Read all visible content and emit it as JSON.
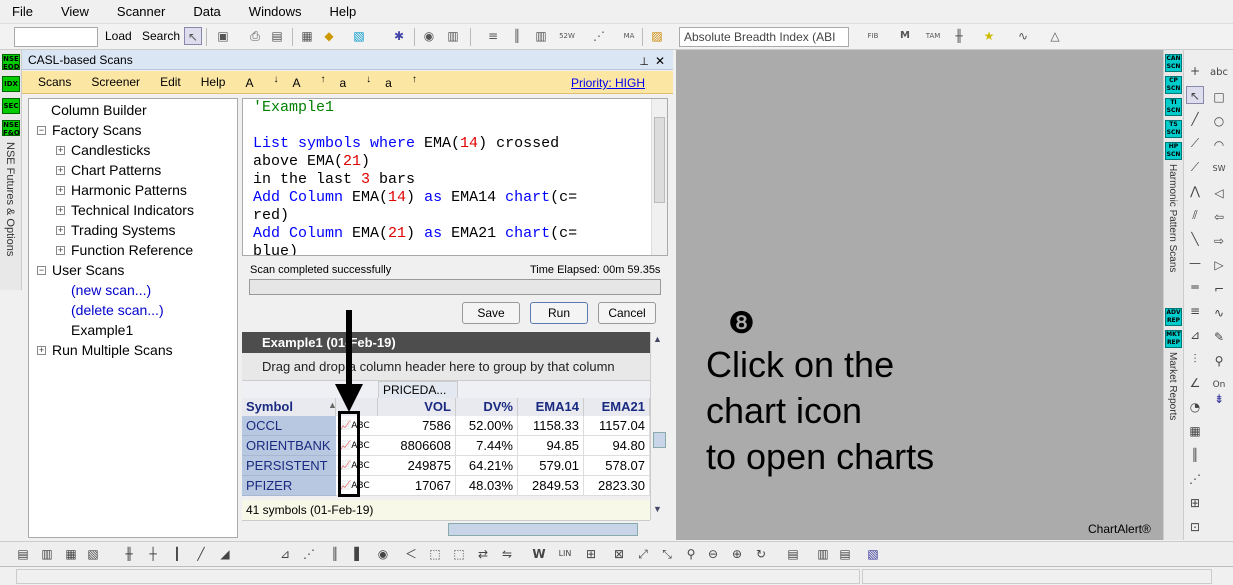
{
  "menu": [
    "File",
    "View",
    "Scanner",
    "Data",
    "Windows",
    "Help"
  ],
  "toolbar": {
    "load": "Load",
    "search": "Search",
    "indicator_select": "Absolute Breadth Index (ABI"
  },
  "left_badges": [
    "NSE EOD",
    "IDX",
    "SEC",
    "NSE F&O"
  ],
  "left_strip_label": "NSE Futures & Options",
  "panel": {
    "title": "CASL-based Scans"
  },
  "scan_menu": {
    "items": [
      "Scans",
      "Screener",
      "Edit",
      "Help"
    ],
    "font_buttons": [
      "A",
      "A",
      "a",
      "a"
    ],
    "priority": "Priority: HIGH"
  },
  "tree": {
    "column_builder": "Column Builder",
    "factory_scans": "Factory Scans",
    "factory_children": [
      "Candlesticks",
      "Chart Patterns",
      "Harmonic Patterns",
      "Technical Indicators",
      "Trading Systems",
      "Function Reference"
    ],
    "user_scans": "User Scans",
    "new_scan": "(new scan...)",
    "delete_scan": "(delete scan...)",
    "example1": "Example1",
    "run_multiple": "Run Multiple Scans"
  },
  "editor": {
    "line1": "'Example1",
    "l2a": "List symbols where",
    "l2b": " EMA(",
    "l2c": "14",
    "l2d": ") crossed",
    "l3a": "above EMA(",
    "l3b": "21",
    "l3c": ")",
    "l4a": "in the last ",
    "l4b": "3",
    "l4c": " bars",
    "l5a": "Add Column",
    "l5b": " EMA(",
    "l5c": "14",
    "l5d": ") ",
    "l5e": "as",
    "l5f": " EMA14 ",
    "l5g": "chart",
    "l5h": "(c=",
    "l6": "red)",
    "l7a": "Add Column",
    "l7b": " EMA(",
    "l7c": "21",
    "l7d": ") ",
    "l7e": "as",
    "l7f": " EMA21 ",
    "l7g": "chart",
    "l7h": "(c=",
    "l8": "blue)"
  },
  "scan_status": "Scan completed successfully",
  "time_elapsed": "Time Elapsed: 00m 59.35s",
  "buttons": {
    "save": "Save",
    "run": "Run",
    "cancel": "Cancel"
  },
  "grid": {
    "title": "Example1 (01-Feb-19)",
    "group_hint": "Drag and drop a column header here to group by that column",
    "band_header": "PRICEDA...",
    "columns": [
      "Symbol",
      "VOL",
      "DV%",
      "EMA14",
      "EMA21"
    ],
    "rows": [
      {
        "symbol": "OCCL",
        "vol": "7586",
        "dv": "52.00%",
        "ema14": "1158.33",
        "ema21": "1157.04"
      },
      {
        "symbol": "ORIENTBANK",
        "vol": "8806608",
        "dv": "7.44%",
        "ema14": "94.85",
        "ema21": "94.80"
      },
      {
        "symbol": "PERSISTENT",
        "vol": "249875",
        "dv": "64.21%",
        "ema14": "579.01",
        "ema21": "578.07"
      },
      {
        "symbol": "PFIZER",
        "vol": "17067",
        "dv": "48.03%",
        "ema14": "2849.53",
        "ema21": "2823.30"
      }
    ],
    "footer": "41 symbols (01-Feb-19)"
  },
  "callout": {
    "number": "❽",
    "line1": "Click on the",
    "line2": "chart icon",
    "line3": "to open charts"
  },
  "watermark": "ChartAlert®",
  "right_badges": [
    "CAN SCN",
    "CP SCN",
    "TI SCN",
    "TS SCN",
    "HP SCN",
    "ADV REP",
    "MKT REP"
  ],
  "right_labels": {
    "harmonic": "Harmonic Pattern Scans",
    "market": "Market Reports"
  }
}
